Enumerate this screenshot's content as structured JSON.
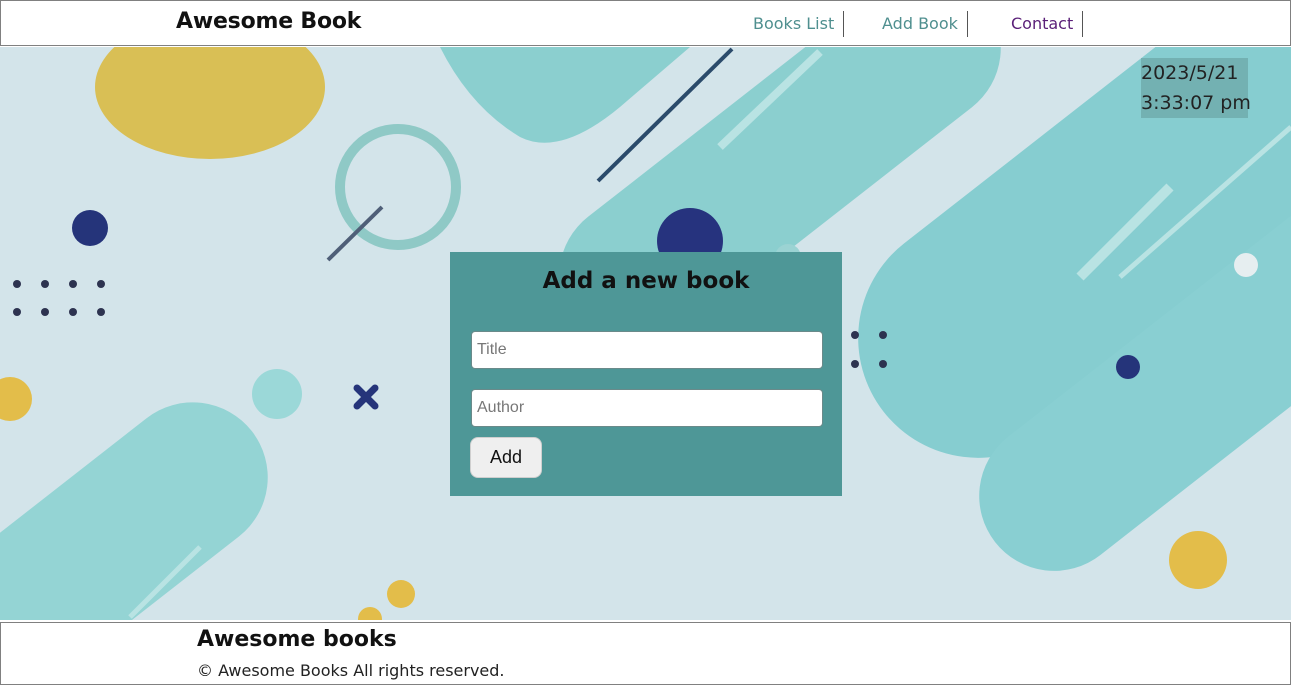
{
  "header": {
    "brand": "Awesome Book",
    "nav": [
      {
        "label": "Books List",
        "color": "#4f8f8f"
      },
      {
        "label": "Add Book",
        "color": "#4f8f8f"
      },
      {
        "label": "Contact",
        "color": "#5a1f78"
      }
    ]
  },
  "datetime": {
    "date": "2023/5/21",
    "time": "3:33:07 pm"
  },
  "form": {
    "title": "Add a new book",
    "title_placeholder": "Title",
    "author_placeholder": "Author",
    "title_value": "",
    "author_value": "",
    "add_label": "Add"
  },
  "footer": {
    "title": "Awesome books",
    "copyright": "© Awesome Books All rights reserved."
  },
  "colors": {
    "panel": "#4e9797",
    "hero_background": "#d3e4ea",
    "accent_teal": "#8fd3d3",
    "accent_yellow": "#e3bd4a",
    "accent_navy": "#25347a"
  }
}
